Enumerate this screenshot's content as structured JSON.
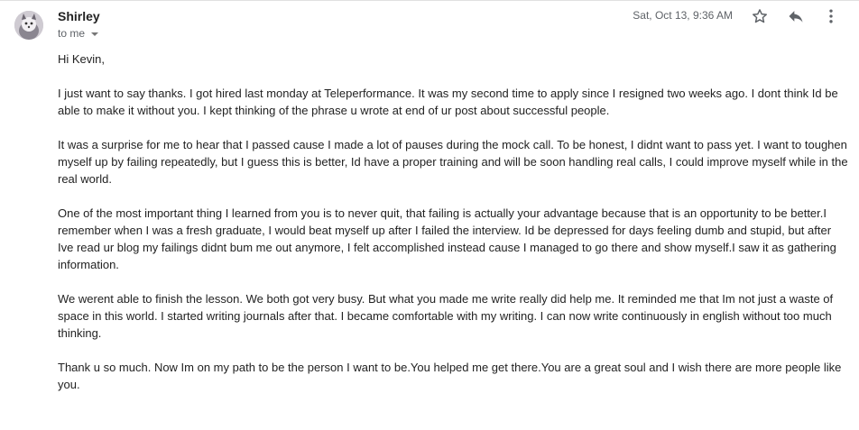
{
  "email": {
    "sender": "Shirley",
    "recipient": "to me",
    "date": "Sat, Oct 13, 9:36 AM",
    "greeting": "Hi Kevin,",
    "paragraphs": [
      "I just want to say thanks. I got hired last monday at Teleperformance. It was my second time to apply since I resigned two weeks ago. I dont think Id be able to make it without you. I kept thinking of the phrase u wrote at end of ur post about successful people.",
      "It was a surprise for me to hear that I passed cause I made a lot of pauses during the mock call. To be honest, I didnt want to pass yet. I want to toughen myself up by failing repeatedly, but I guess this is better, Id have a proper training and will be soon handling real calls, I could improve myself while in the real world.",
      "One of the most important thing I learned from you is to never quit, that failing is actually your advantage because that is an opportunity to be better.I remember when I was a fresh graduate, I would beat myself up after I failed the interview. Id be depressed for days feeling dumb and stupid, but after Ive read ur blog my failings didnt bum me out anymore, I felt accomplished instead cause I managed to go there and show myself.I saw it as gathering information.",
      "We werent able to finish the lesson. We both got very busy. But what you made me write really did help me. It reminded me that Im not just a waste of space in this world. I started writing journals after that. I became comfortable with my writing. I can now write continuously in english without too much thinking.",
      "Thank u so much. Now Im on my path to be the person I want to be.You helped me get there.You are a great soul and I wish there are more people like you."
    ]
  },
  "icons": {
    "avatar": "avatar-photo",
    "star": "star-icon",
    "reply": "reply-icon",
    "more": "more-vertical-icon",
    "dropdown": "chevron-down-icon"
  }
}
